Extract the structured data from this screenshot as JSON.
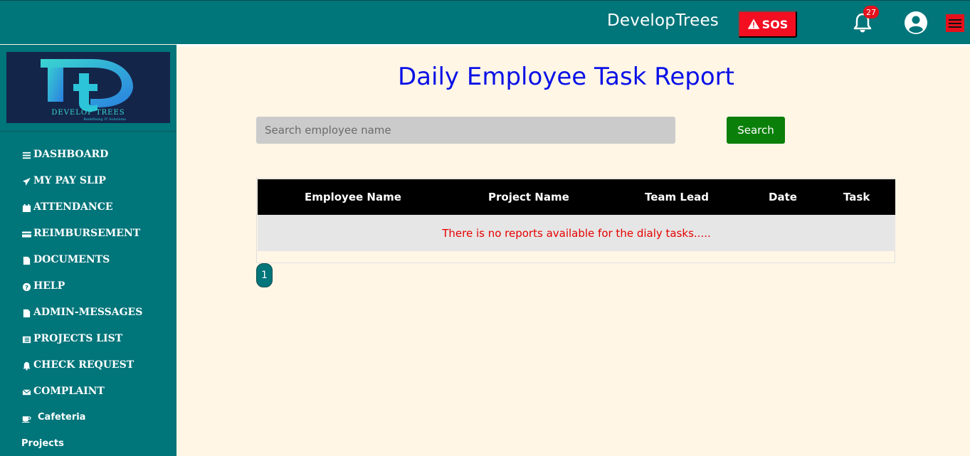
{
  "header": {
    "brand": "DevelopTrees",
    "sos_label": "SOS",
    "notification_count": "27"
  },
  "sidebar": {
    "logo_text": "DEVELOP TREES",
    "logo_tagline": "Redefining IT Solutions",
    "items": [
      {
        "label": "DASHBOARD",
        "icon": "bars-icon"
      },
      {
        "label": "MY PAY SLIP",
        "icon": "paper-plane-icon"
      },
      {
        "label": "ATTENDANCE",
        "icon": "calendar-icon"
      },
      {
        "label": "REIMBURSEMENT",
        "icon": "credit-card-icon"
      },
      {
        "label": "DOCUMENTS",
        "icon": "file-icon"
      },
      {
        "label": "HELP",
        "icon": "question-circle-icon"
      },
      {
        "label": "ADMIN-MESSAGES",
        "icon": "file-icon"
      },
      {
        "label": "PROJECTS LIST",
        "icon": "list-icon"
      },
      {
        "label": "CHECK REQUEST",
        "icon": "bell-icon"
      },
      {
        "label": "COMPLAINT",
        "icon": "envelope-icon"
      },
      {
        "label": "Cafeteria",
        "icon": "coffee-icon"
      },
      {
        "label": "Projects",
        "icon": "none"
      }
    ]
  },
  "main": {
    "title": "Daily Employee Task Report",
    "search_placeholder": "Search employee name",
    "search_button": "Search",
    "table": {
      "columns": [
        "Employee Name",
        "Project Name",
        "Team Lead",
        "Date",
        "Task"
      ],
      "empty_message": "There is no reports available for the dialy tasks....."
    },
    "pagination": {
      "current_page": "1"
    }
  },
  "colors": {
    "topbar": "#00757a",
    "sidebar": "#00757a",
    "page_bg": "#fff6e6",
    "title": "#0a11e6",
    "sos": "#f30e21",
    "search_button": "#0a7f0a",
    "empty_message": "#e60000"
  }
}
